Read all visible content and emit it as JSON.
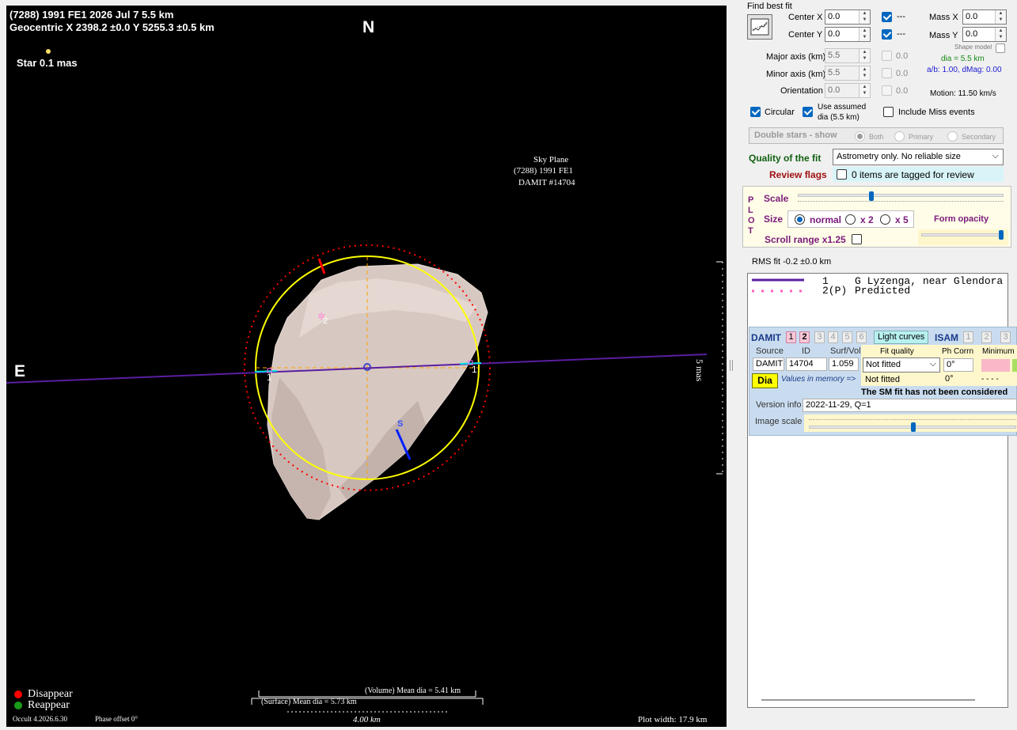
{
  "plot": {
    "title_line1": "(7288) 1991 FE1  2026 Jul 7   5.5 km",
    "title_line2": "Geocentric  X  2398.2 ±0.0  Y 5255.3 ±0.5 km",
    "north": "N",
    "east": "E",
    "star_label": "Star 0.1 mas",
    "sky_plane": "Sky Plane",
    "sky_object": "(7288) 1991 FE1",
    "sky_damit": "DAMIT #14704",
    "scale_bar_label": "5 mas",
    "chord_label_1": "1",
    "chord_label_2": "1",
    "spot_label": "2",
    "south_label": "S",
    "legend_disappear": "Disappear",
    "legend_reappear": "Reappear",
    "volume_dia": "(Volume) Mean dia = 5.41 km",
    "surface_dia": "(Surface) Mean dia = 5.73 km",
    "km_scale": "4.00 km",
    "version": "Occult 4.2026.6.30",
    "phase_offset": "Phase offset 0°",
    "plot_width": "Plot width: 17.9 km",
    "colors": {
      "disappear": "#ff0000",
      "reappear": "#1a9a1a",
      "fit_circle": "#ffff00",
      "chord": "#5a1ea0"
    }
  },
  "panel": {
    "find_best_fit": "Find best fit",
    "center_x_label": "Center X",
    "center_x_value": "0.0",
    "center_y_label": "Center Y",
    "center_y_value": "0.0",
    "center_x_uncert": "---",
    "center_y_uncert": "---",
    "mass_x_label": "Mass X",
    "mass_x_value": "0.0",
    "mass_y_label": "Mass Y",
    "mass_y_value": "0.0",
    "shape_model": "Shape model",
    "major_axis_label": "Major axis (km)",
    "major_axis_value": "5.5",
    "major_axis_uncert": "0.0",
    "minor_axis_label": "Minor axis (km)",
    "minor_axis_value": "5.5",
    "minor_axis_uncert": "0.0",
    "orientation_label": "Orientation",
    "orientation_value": "0.0",
    "orientation_uncert": "0.0",
    "dia_text": "dia = 5.5 km",
    "ab_text": "a/b: 1.00, dMag: 0.00",
    "motion_text": "Motion: 11.50 km/s",
    "circular_label": "Circular",
    "use_assumed_label_1": "Use assumed",
    "use_assumed_label_2": "dia (5.5 km)",
    "include_miss_label": "Include Miss events",
    "double_stars_label": "Double stars - show",
    "both_label": "Both",
    "primary_label": "Primary",
    "secondary_label": "Secondary",
    "quality_label": "Quality of the fit",
    "quality_value": "Astrometry only. No reliable size",
    "review_flags_label": "Review flags",
    "review_items": "0 items are tagged for review",
    "plot_letters": [
      "P",
      "L",
      "O",
      "T"
    ],
    "scale_label": "Scale",
    "size_label": "Size",
    "size_normal": "normal",
    "size_x2": "x 2",
    "size_x5": "x 5",
    "form_opacity": "Form opacity",
    "scroll_range": "Scroll range x1.25",
    "rms_fit": "RMS fit -0.2 ±0.0 km",
    "list_line1_num": "1",
    "list_line1_text": "G Lyzenga, near Glendora",
    "list_line2_num": "2(P)",
    "list_line2_text": "Predicted",
    "damit_label": "DAMIT",
    "damit_tabs": [
      "1",
      "2",
      "3",
      "4",
      "5",
      "6"
    ],
    "light_curves": "Light curves",
    "isam_label": "ISAM",
    "isam_tabs": [
      "1",
      "2",
      "3"
    ],
    "source_hdr": "Source",
    "id_hdr": "ID",
    "surfvol_hdr": "Surf/Vol",
    "fit_quality_hdr": "Fit quality",
    "ph_corrn_hdr": "Ph Corrn",
    "minimum_hdr": "Minimum",
    "source_val": "DAMIT",
    "id_val": "14704",
    "surfvol_val": "1.059",
    "fit_quality_val": "Not fitted",
    "ph_corrn_val": "0°",
    "memory_fit": "Not fitted",
    "memory_ph": "0°",
    "memory_min": "- - - -",
    "dia_button": "Dia",
    "values_in_memory": "Values in memory =>",
    "sm_fit_note": "The SM fit has not been considered",
    "version_info_label": "Version info",
    "version_info_value": "2022-11-29, Q=1",
    "image_scale_label": "Image scale"
  }
}
